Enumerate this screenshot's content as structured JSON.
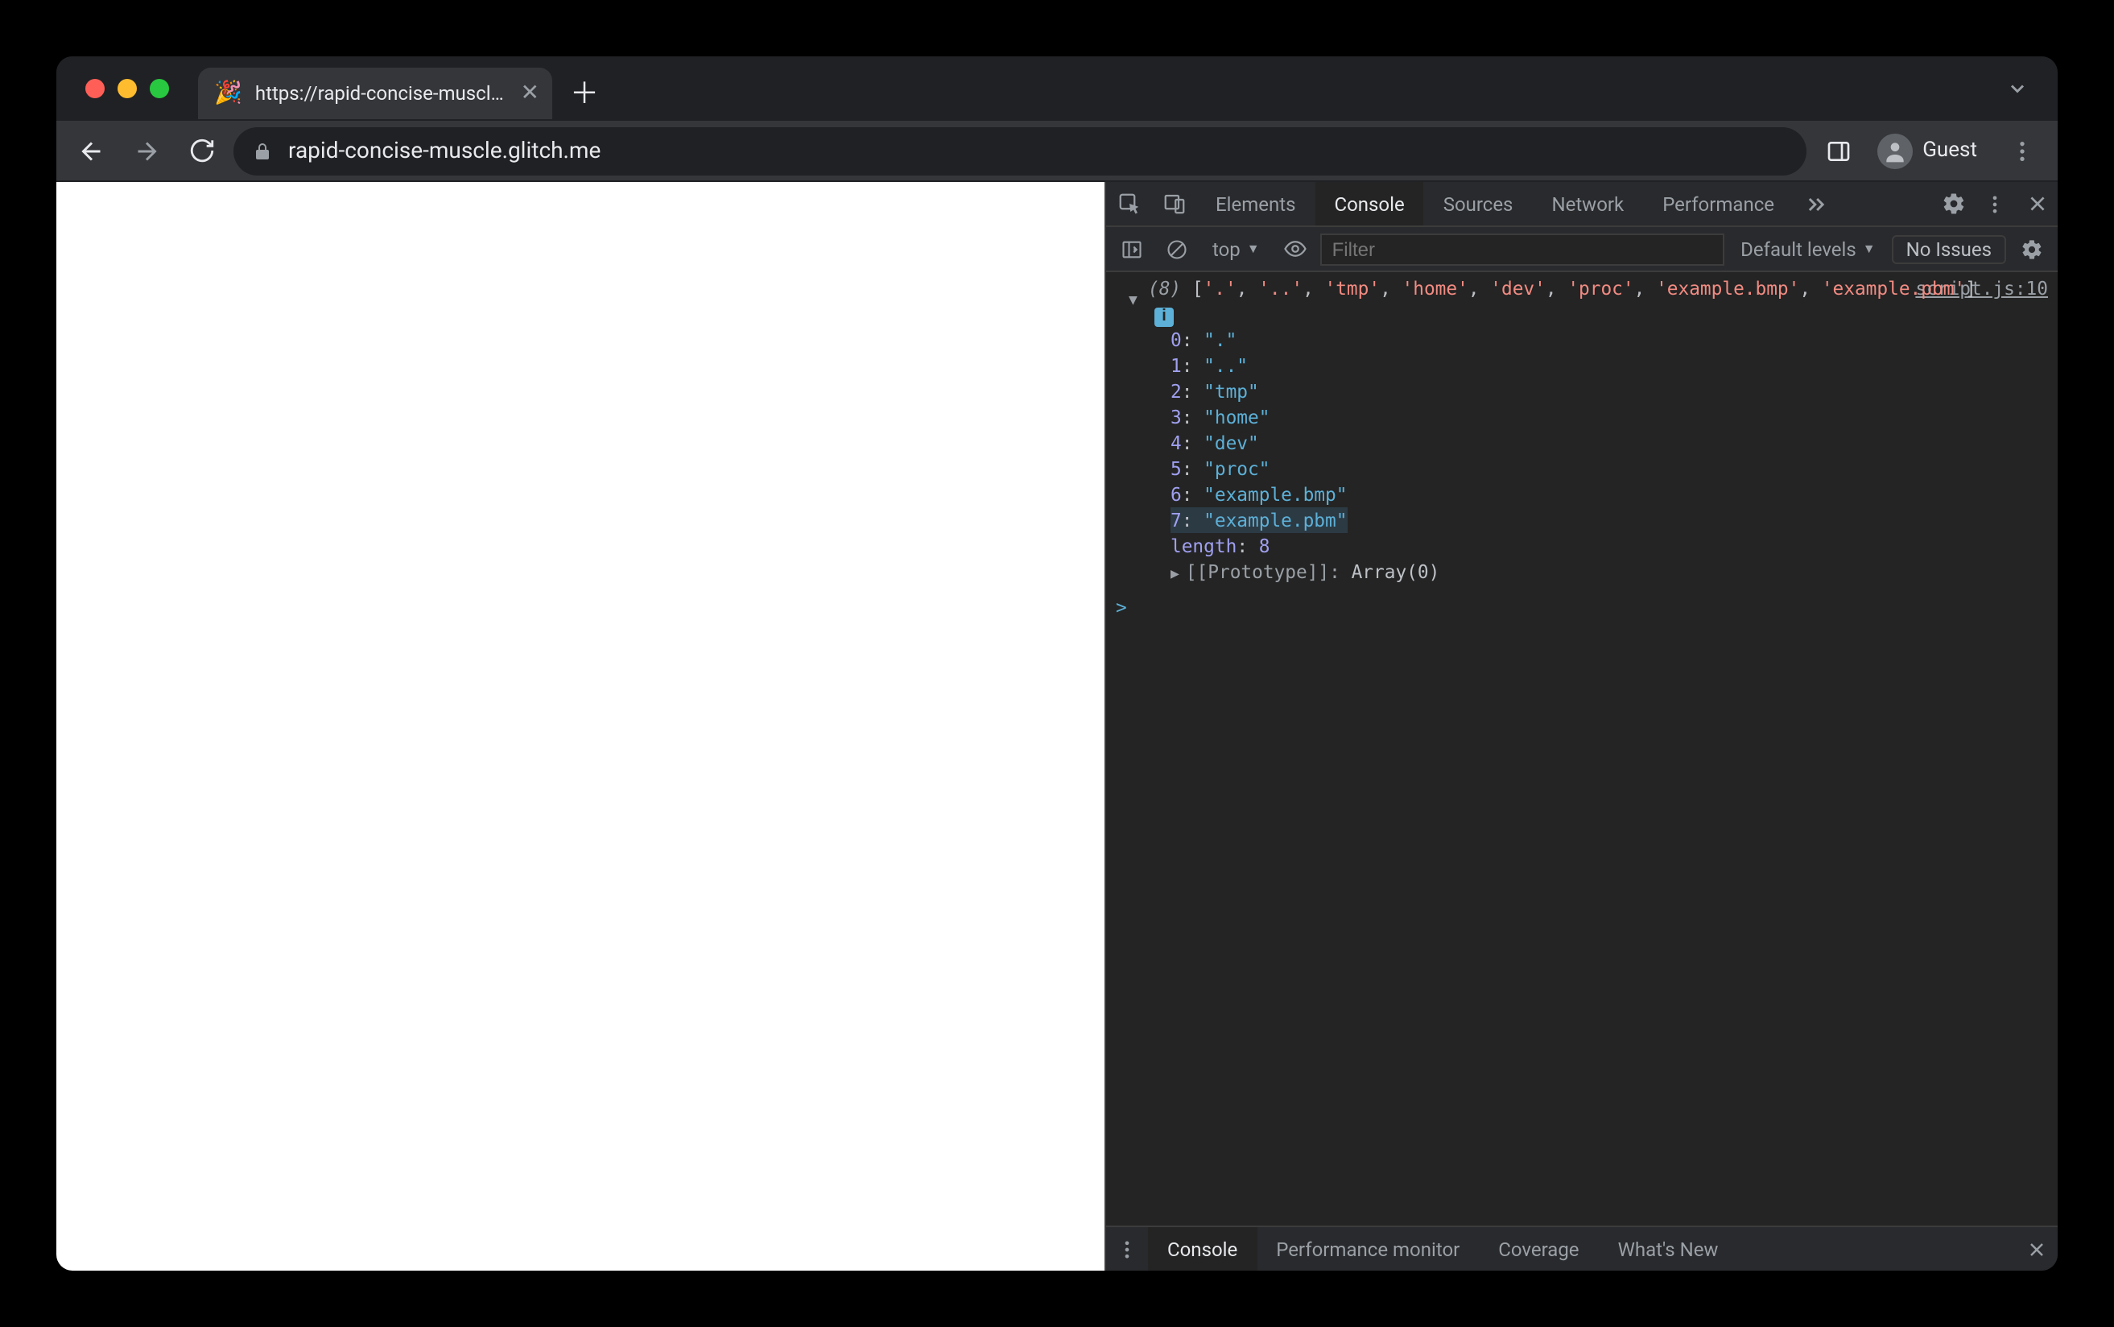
{
  "browser": {
    "tab": {
      "favicon": "🎉",
      "title": "https://rapid-concise-muscle.g"
    },
    "toolbar": {
      "url": "rapid-concise-muscle.glitch.me",
      "profile_label": "Guest"
    }
  },
  "devtools": {
    "tabs": [
      "Elements",
      "Console",
      "Sources",
      "Network",
      "Performance"
    ],
    "active_tab": "Console",
    "console_toolbar": {
      "context": "top",
      "filter_placeholder": "Filter",
      "levels": "Default levels",
      "issues": "No Issues"
    },
    "console": {
      "source_link": "script.js:10",
      "array_count": "(8)",
      "array_summary": [
        "'.'",
        "'..'",
        "'tmp'",
        "'home'",
        "'dev'",
        "'proc'",
        "'example.bmp'",
        "'example.pbm'"
      ],
      "entries": [
        {
          "index": "0",
          "value": "\".\""
        },
        {
          "index": "1",
          "value": "\"..\""
        },
        {
          "index": "2",
          "value": "\"tmp\""
        },
        {
          "index": "3",
          "value": "\"home\""
        },
        {
          "index": "4",
          "value": "\"dev\""
        },
        {
          "index": "5",
          "value": "\"proc\""
        },
        {
          "index": "6",
          "value": "\"example.bmp\""
        },
        {
          "index": "7",
          "value": "\"example.pbm\"",
          "highlight": true
        }
      ],
      "length_label": "length",
      "length_value": "8",
      "proto_label": "[[Prototype]]",
      "proto_value": "Array(0)",
      "prompt": ">"
    },
    "drawer": {
      "tabs": [
        "Console",
        "Performance monitor",
        "Coverage",
        "What's New"
      ],
      "active": "Console"
    }
  }
}
